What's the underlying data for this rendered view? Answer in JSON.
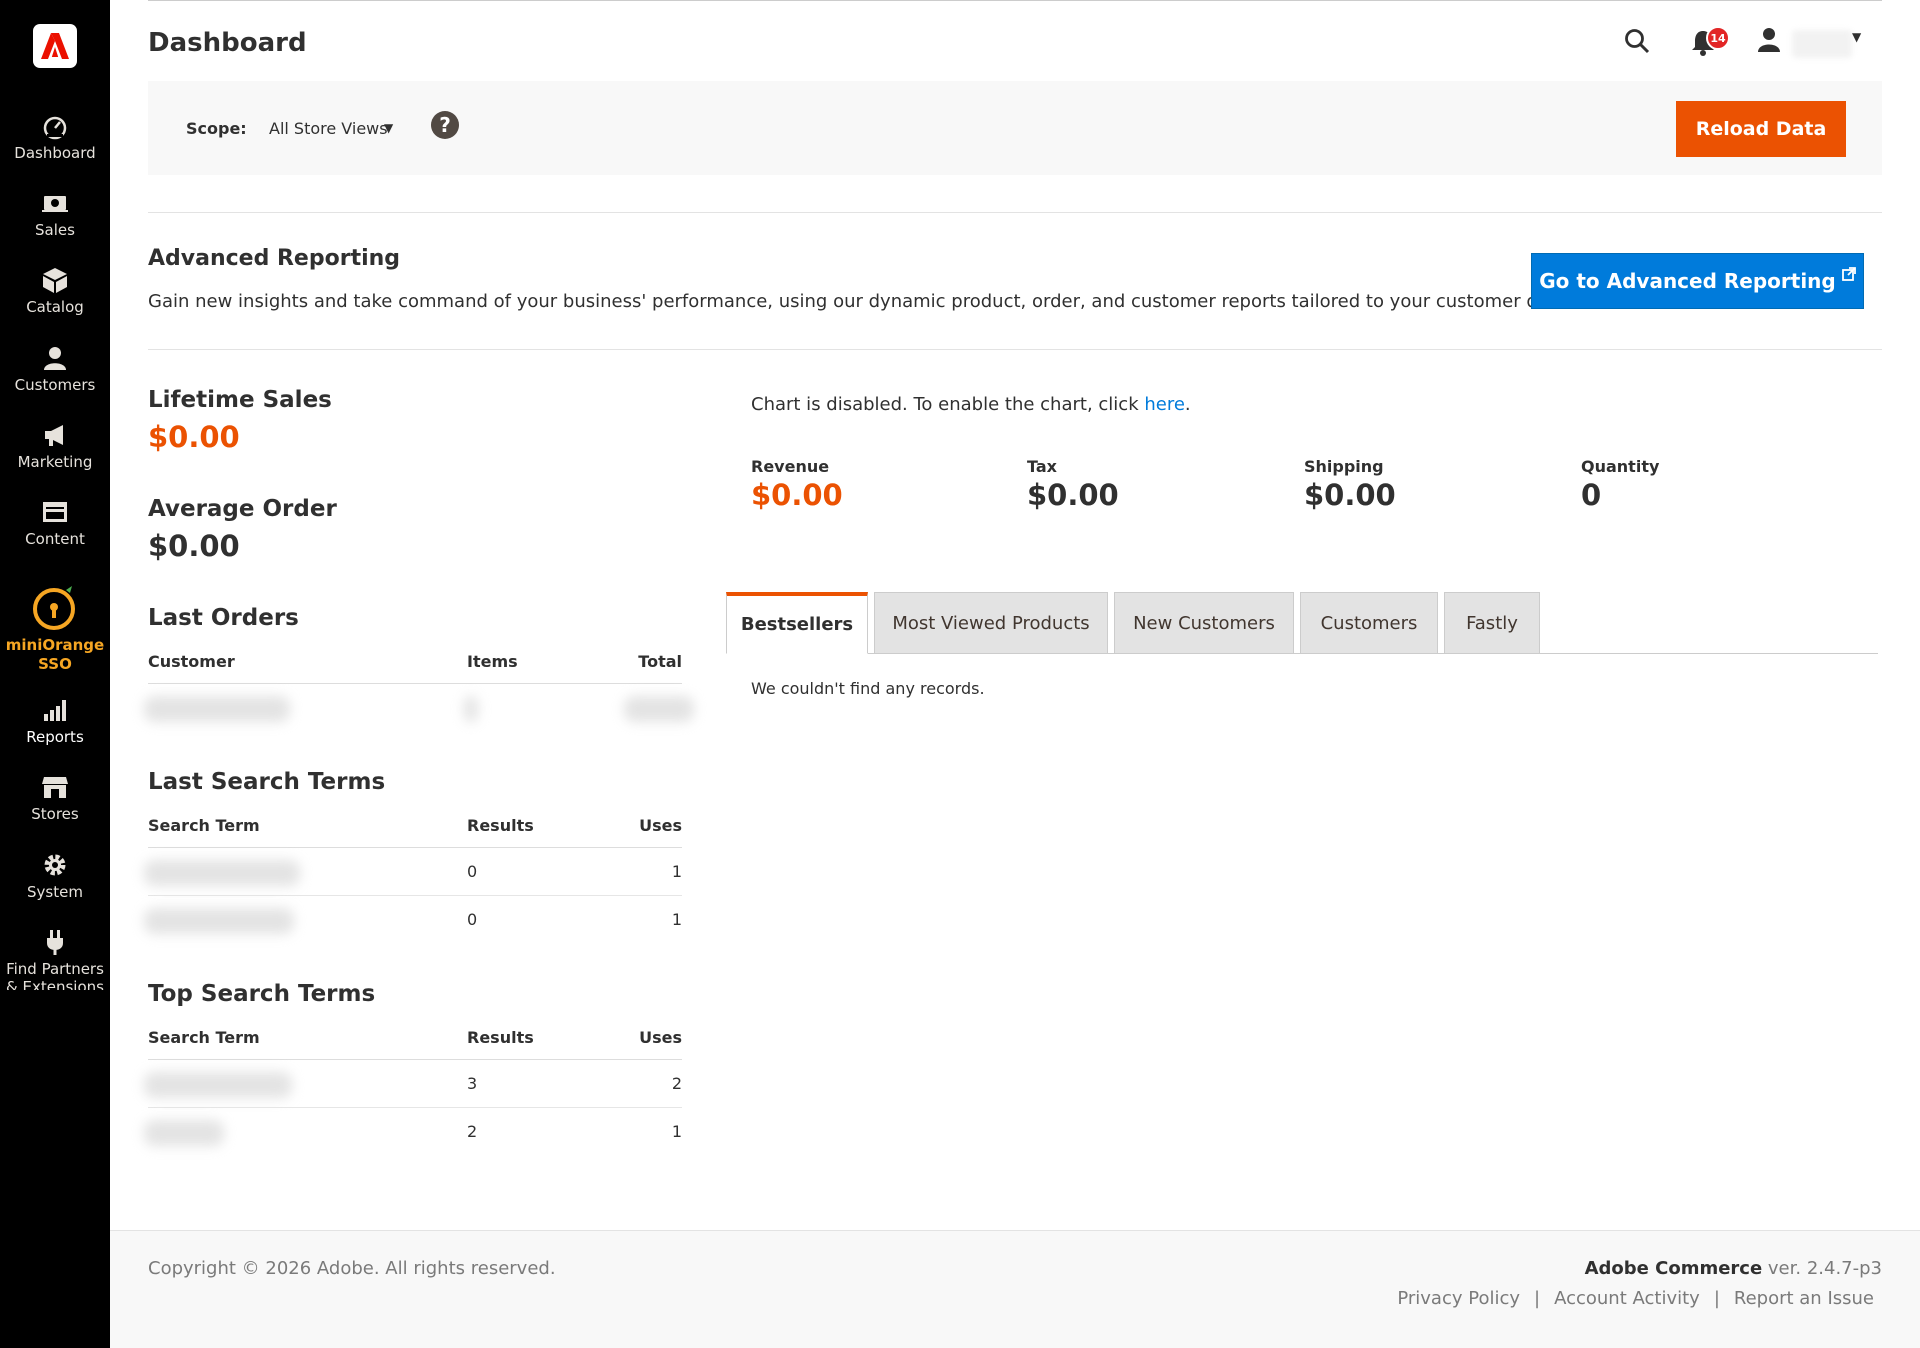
{
  "sidebar": {
    "items": [
      {
        "label": "Dashboard",
        "icon": "dashboard-icon"
      },
      {
        "label": "Sales",
        "icon": "sales-icon"
      },
      {
        "label": "Catalog",
        "icon": "catalog-icon"
      },
      {
        "label": "Customers",
        "icon": "customers-icon"
      },
      {
        "label": "Marketing",
        "icon": "marketing-icon"
      },
      {
        "label": "Content",
        "icon": "content-icon"
      },
      {
        "label": "miniOrange SSO",
        "icon": "miniorange-icon"
      },
      {
        "label": "Reports",
        "icon": "reports-icon"
      },
      {
        "label": "Stores",
        "icon": "stores-icon"
      },
      {
        "label": "System",
        "icon": "system-icon"
      },
      {
        "label": "Find Partners & Extensions",
        "icon": "plug-icon"
      }
    ]
  },
  "header": {
    "title": "Dashboard",
    "notification_count": "14"
  },
  "scope": {
    "label": "Scope:",
    "value": "All Store Views",
    "help": "?",
    "reload_label": "Reload Data"
  },
  "advanced_reporting": {
    "title": "Advanced Reporting",
    "description": "Gain new insights and take command of your business' performance, using our dynamic product, order, and customer reports tailored to your customer data.",
    "button_label": "Go to Advanced Reporting"
  },
  "stats": {
    "lifetime_sales_label": "Lifetime Sales",
    "lifetime_sales_value": "$0.00",
    "average_order_label": "Average Order",
    "average_order_value": "$0.00"
  },
  "last_orders": {
    "title": "Last Orders",
    "headers": [
      "Customer",
      "Items",
      "Total"
    ]
  },
  "last_search_terms": {
    "title": "Last Search Terms",
    "headers": [
      "Search Term",
      "Results",
      "Uses"
    ],
    "rows": [
      {
        "results": "0",
        "uses": "1"
      },
      {
        "results": "0",
        "uses": "1"
      }
    ]
  },
  "top_search_terms": {
    "title": "Top Search Terms",
    "headers": [
      "Search Term",
      "Results",
      "Uses"
    ],
    "rows": [
      {
        "results": "3",
        "uses": "2"
      },
      {
        "results": "2",
        "uses": "1"
      }
    ]
  },
  "chart": {
    "message": "Chart is disabled. To enable the chart, click ",
    "link": "here",
    "suffix": "."
  },
  "totals": [
    {
      "label": "Revenue",
      "value": "$0.00"
    },
    {
      "label": "Tax",
      "value": "$0.00"
    },
    {
      "label": "Shipping",
      "value": "$0.00"
    },
    {
      "label": "Quantity",
      "value": "0"
    }
  ],
  "tabs": [
    "Bestsellers",
    "Most Viewed Products",
    "New Customers",
    "Customers",
    "Fastly"
  ],
  "tab_content": "We couldn't find any records.",
  "footer": {
    "copyright": "Copyright © 2026 Adobe. All rights reserved.",
    "product": "Adobe Commerce",
    "version": " ver. 2.4.7-p3",
    "links": [
      "Privacy Policy",
      "Account Activity",
      "Report an Issue"
    ]
  },
  "colors": {
    "accent": "#eb5202",
    "link": "#007bdb",
    "sidebar": "#000000"
  }
}
